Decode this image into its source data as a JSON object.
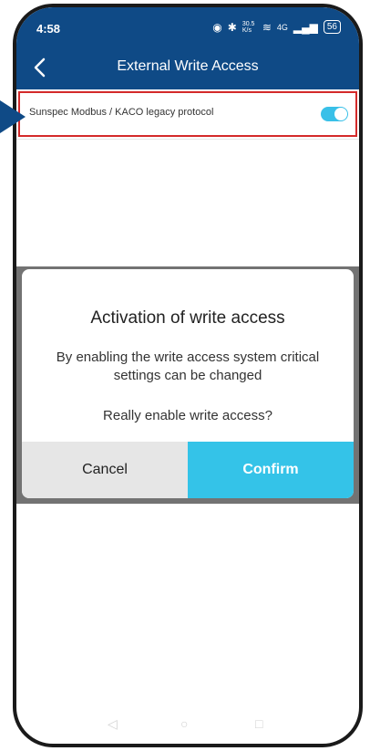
{
  "status_bar": {
    "time": "4:58",
    "net_speed": "30.5 K/s",
    "signal": "4G",
    "battery": "56"
  },
  "header": {
    "title": "External Write Access"
  },
  "settings": {
    "protocol_label": "Sunspec Modbus / KACO legacy protocol",
    "toggle_state": "on"
  },
  "dialog": {
    "title": "Activation of write access",
    "message": "By enabling the write access system critical settings can be changed",
    "question": "Really enable write access?",
    "cancel_label": "Cancel",
    "confirm_label": "Confirm"
  },
  "colors": {
    "header_bg": "#0f4a86",
    "accent": "#34c3e8",
    "highlight": "#d42a2a",
    "cancel_bg": "#e6e6e6"
  },
  "icons": [
    "back-arrow-icon",
    "eye-icon",
    "bluetooth-icon",
    "wifi-icon",
    "signal-icon",
    "battery-icon",
    "pointer-arrow-icon"
  ]
}
